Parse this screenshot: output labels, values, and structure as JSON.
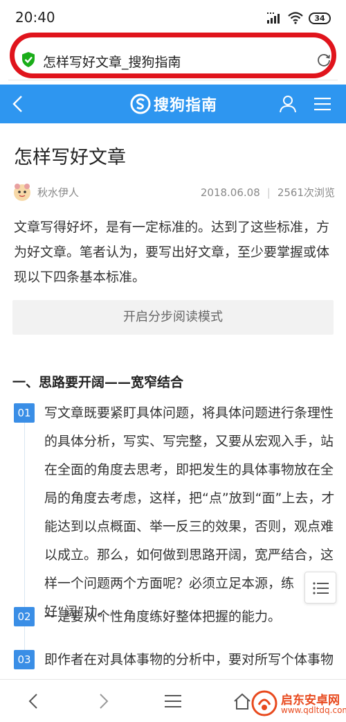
{
  "status_bar": {
    "time": "20:40",
    "battery": "34"
  },
  "url_bar": {
    "title": "怎样写好文章_搜狗指南"
  },
  "header": {
    "logo_text": "搜狗指南"
  },
  "article": {
    "title": "怎样写好文章",
    "author": "秋水伊人",
    "date": "2018.06.08",
    "views": "2561次浏览",
    "intro": "文章写得好坏，是有一定标准的。达到了这些标准，方为好文章。笔者认为，要写出好文章，至少要掌握或体现以下四条基本标准。",
    "step_mode_label": "开启分步阅读模式",
    "section_heading": "一、思路要开阔——宽窄结合",
    "steps": [
      {
        "num": "01",
        "text": "写文章既要紧盯具体问题，将具体问题进行条理性的具体分析，写实、写完整，又要从宏观入手，站在全面的角度去思考，即把发生的具体事物放在全局的角度去考虑，这样，把“点”放到“面”上去，才能达到以点概面、举一反三的效果，否则，观点难以成立。那么，如何做到思路开阔，宽严结合，这样一个问题两个方面呢？必须立足本源，练好“阔”功。"
      },
      {
        "num": "02",
        "text": "一是要从个性角度练好整体把握的能力。"
      },
      {
        "num": "03",
        "text": "即作者在对具体事物的分析中，要对所写个体事物有具体的“实”的方面有个全面的把握，即"
      }
    ]
  },
  "watermark": {
    "text1": "启东安卓网",
    "text2": "www.qdltdq.com"
  },
  "colors": {
    "header_bg": "#2e96f0",
    "step_badge": "#3a8ee6",
    "highlight": "#e0141c"
  }
}
